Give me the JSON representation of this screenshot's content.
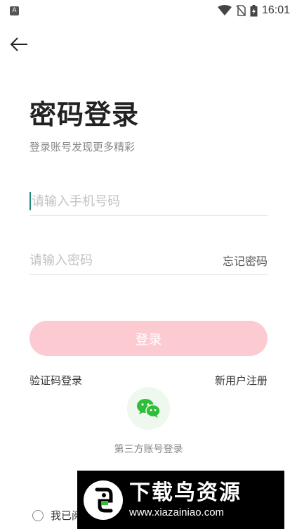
{
  "status_bar": {
    "app_badge": "A",
    "time": "16:01",
    "icons": [
      "wifi-icon",
      "no-sim-icon",
      "battery-charging-icon"
    ]
  },
  "header": {
    "back_icon": "arrow-left-icon"
  },
  "login": {
    "title": "密码登录",
    "subtitle": "登录账号发现更多精彩",
    "phone_placeholder": "请输入手机号码",
    "password_placeholder": "请输入密码",
    "forgot_label": "忘记密码",
    "login_button": "登录",
    "sms_login_link": "验证码登录",
    "register_link": "新用户注册",
    "third_party_label": "第三方账号登录",
    "third_party_icon": "wechat-icon",
    "agreement_text": "我已阅"
  },
  "watermark": {
    "text_cn": "下载鸟资源",
    "url": "www.xiazainiao.com"
  },
  "colors": {
    "accent_caret": "#1e8c7a",
    "login_button_bg": "#fccbd2",
    "wechat_green": "#2fbe3a",
    "wechat_circle_bg": "#eef8ee"
  }
}
